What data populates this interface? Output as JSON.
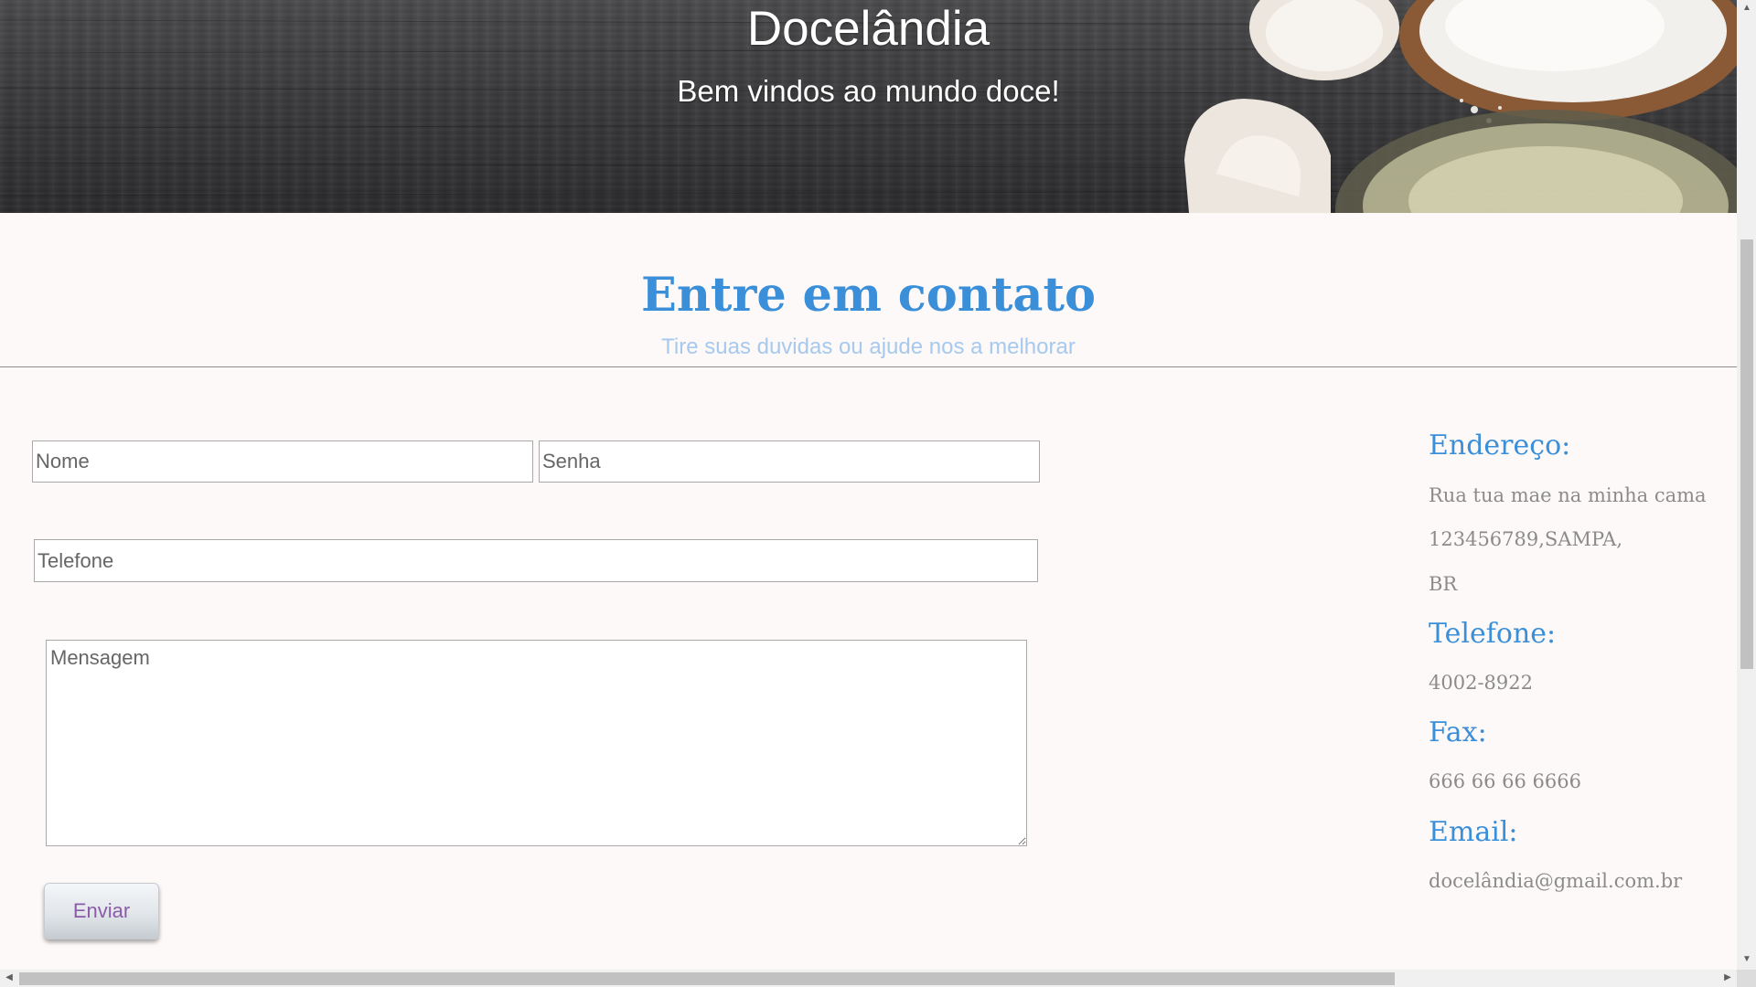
{
  "hero": {
    "title": "Docelândia",
    "subtitle": "Bem vindos ao mundo doce!"
  },
  "contact_section": {
    "title": "Entre em contato",
    "subtitle": "Tire suas duvidas ou ajude nos a melhorar"
  },
  "form": {
    "nome_placeholder": "Nome",
    "senha_placeholder": "Senha",
    "telefone_placeholder": "Telefone",
    "mensagem_placeholder": "Mensagem",
    "submit_label": "Enviar"
  },
  "info": {
    "address_heading": "Endereço:",
    "address_lines": [
      "Rua tua mae na minha cama",
      "123456789,SAMPA,",
      "BR"
    ],
    "phone_heading": "Telefone:",
    "phone": "4002-8922",
    "fax_heading": "Fax:",
    "fax": "666 66 66 6666",
    "email_heading": "Email:",
    "email": "docelândia@gmail.com.br"
  },
  "scrollbars": {
    "up_icon": "arrow-up-icon",
    "down_icon": "arrow-down-icon",
    "left_icon": "arrow-left-icon",
    "right_icon": "arrow-right-icon"
  },
  "colors": {
    "accent": "#3b8fd8",
    "subtitle": "#a6c9ed",
    "info_text": "#8b8b8b",
    "button_text": "#8a5ca8",
    "page_bg": "#fdf9f8"
  }
}
